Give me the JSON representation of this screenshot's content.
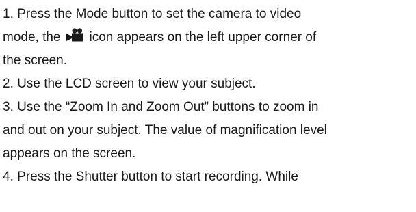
{
  "steps": [
    {
      "line1_before_icon": "1. Press the Mode button to set the camera to video",
      "line2_before_icon": "mode, the",
      "icon": "video-camera-icon",
      "line2_after_icon": "icon appears on the left upper corner of",
      "line3": "the screen."
    },
    {
      "line1": "2. Use the LCD screen to view your subject."
    },
    {
      "line1": "3. Use the “Zoom In and Zoom Out” buttons to zoom in",
      "line2": "and out on your subject. The value of magnification level",
      "line3": "appears on the screen."
    },
    {
      "line1": "4. Press the Shutter button to start recording. While"
    }
  ]
}
